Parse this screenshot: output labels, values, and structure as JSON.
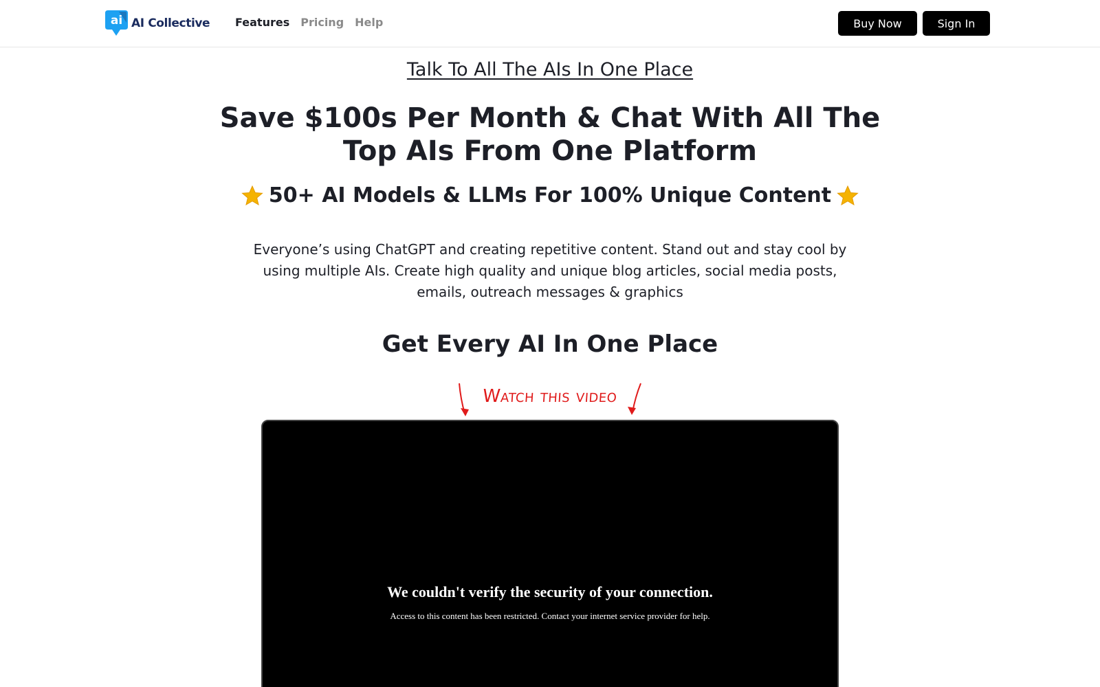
{
  "header": {
    "logo_text": "AI Collective",
    "logo_mark_text": "ai",
    "nav": [
      {
        "label": "Features"
      },
      {
        "label": "Pricing"
      },
      {
        "label": "Help"
      }
    ],
    "buy_label": "Buy Now",
    "signin_label": "Sign In"
  },
  "hero": {
    "tagline": "Talk To All The AIs In One Place",
    "headline_line1": "Save $100s Per Month & Chat With All The",
    "headline_line2": "Top AIs From One Platform",
    "subhead": "50+ AI Models & LLMs For 100% Unique Content",
    "description": "Everyone’s using ChatGPT and creating repetitive content. Stand out and stay cool by using multiple AIs. Create high quality and unique blog articles, social media posts, emails, outreach messages & graphics",
    "section_title": "Get Every AI In One Place",
    "watch_label": "Watch this video"
  },
  "video": {
    "title": "We couldn't verify the security of your connection.",
    "message": "Access to this content has been restricted. Contact your internet service provider for help."
  },
  "icons": {
    "star": "star-icon",
    "arrow": "hand-drawn-arrow-icon"
  },
  "colors": {
    "brand_blue": "#1da1f2",
    "brand_navy": "#1a2b5e",
    "accent_red": "#e01b1b",
    "star_gold": "#f5b301"
  }
}
